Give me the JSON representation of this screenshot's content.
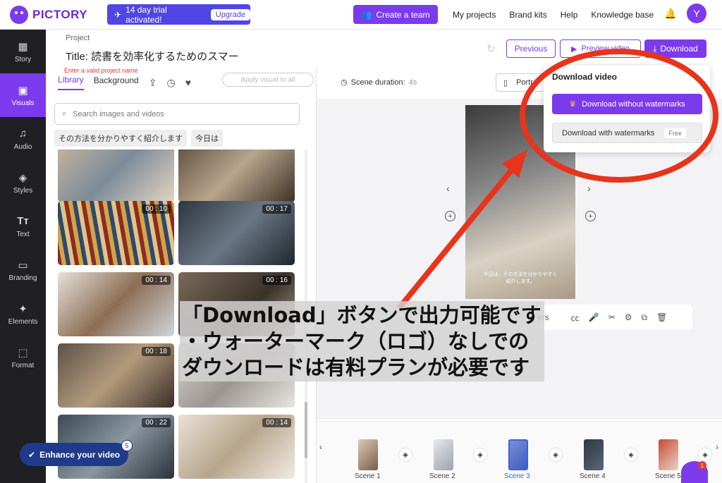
{
  "app": {
    "logo_text": "PICTORY",
    "trial_text": "14 day trial activated!",
    "upgrade_label": "Upgrade",
    "create_team_label": "Create a team",
    "nav": [
      "My projects",
      "Brand kits",
      "Help",
      "Knowledge base"
    ],
    "avatar_letter": "Y"
  },
  "rail": [
    {
      "label": "Story",
      "icon": "grid-icon"
    },
    {
      "label": "Visuals",
      "icon": "image-icon",
      "active": true
    },
    {
      "label": "Audio",
      "icon": "music-icon"
    },
    {
      "label": "Styles",
      "icon": "styles-icon"
    },
    {
      "label": "Text",
      "icon": "text-icon"
    },
    {
      "label": "Branding",
      "icon": "briefcase-icon"
    },
    {
      "label": "Elements",
      "icon": "elements-icon"
    },
    {
      "label": "Format",
      "icon": "format-icon"
    }
  ],
  "project": {
    "label": "Project",
    "title": "Title: 読書を効率化するためのスマー",
    "error": "Enter a valid project name"
  },
  "panel": {
    "tabs": [
      "Library",
      "Background"
    ],
    "apply_all": "Apply visual to all",
    "search_placeholder": "Search images and videos",
    "chips": [
      "その方法を分かりやすく紹介します",
      "今日は"
    ],
    "thumbnails": [
      {
        "duration": ""
      },
      {
        "duration": ""
      },
      {
        "duration": "00 : 10"
      },
      {
        "duration": "00 : 17"
      },
      {
        "duration": "00 : 14"
      },
      {
        "duration": "00 : 16"
      },
      {
        "duration": "00 : 18"
      },
      {
        "duration": ""
      },
      {
        "duration": "00 : 22"
      },
      {
        "duration": "00 : 14"
      }
    ],
    "enhance_label": "Enhance your video",
    "enhance_badge": "5"
  },
  "header": {
    "previous_label": "Previous",
    "preview_label": "Preview video",
    "download_label": "Download",
    "scene_duration_label": "Scene duration:",
    "scene_duration_value": "4s",
    "portrait_label": "Portr"
  },
  "video": {
    "caption_line1": "今日は、その方法を分かりやすく",
    "caption_line2": "紹介します。"
  },
  "toolbar": {
    "partial_label": "ers"
  },
  "scenes": [
    {
      "label": "Scene 1"
    },
    {
      "label": "Scene 2"
    },
    {
      "label": "Scene 3",
      "active": true
    },
    {
      "label": "Scene 4"
    },
    {
      "label": "Scene 5"
    }
  ],
  "chat_badge": "1",
  "popover": {
    "title": "Download video",
    "without_watermarks": "Download without watermarks",
    "with_watermarks": "Download with watermarks",
    "free_badge": "Free"
  },
  "annotation": {
    "line1": "「Download」ボタンで出力可能です",
    "line2": "・ウォーターマーク（ロゴ）なしでの",
    "line3": "ダウンロードは有料プランが必要です",
    "color": "#e8341c"
  }
}
